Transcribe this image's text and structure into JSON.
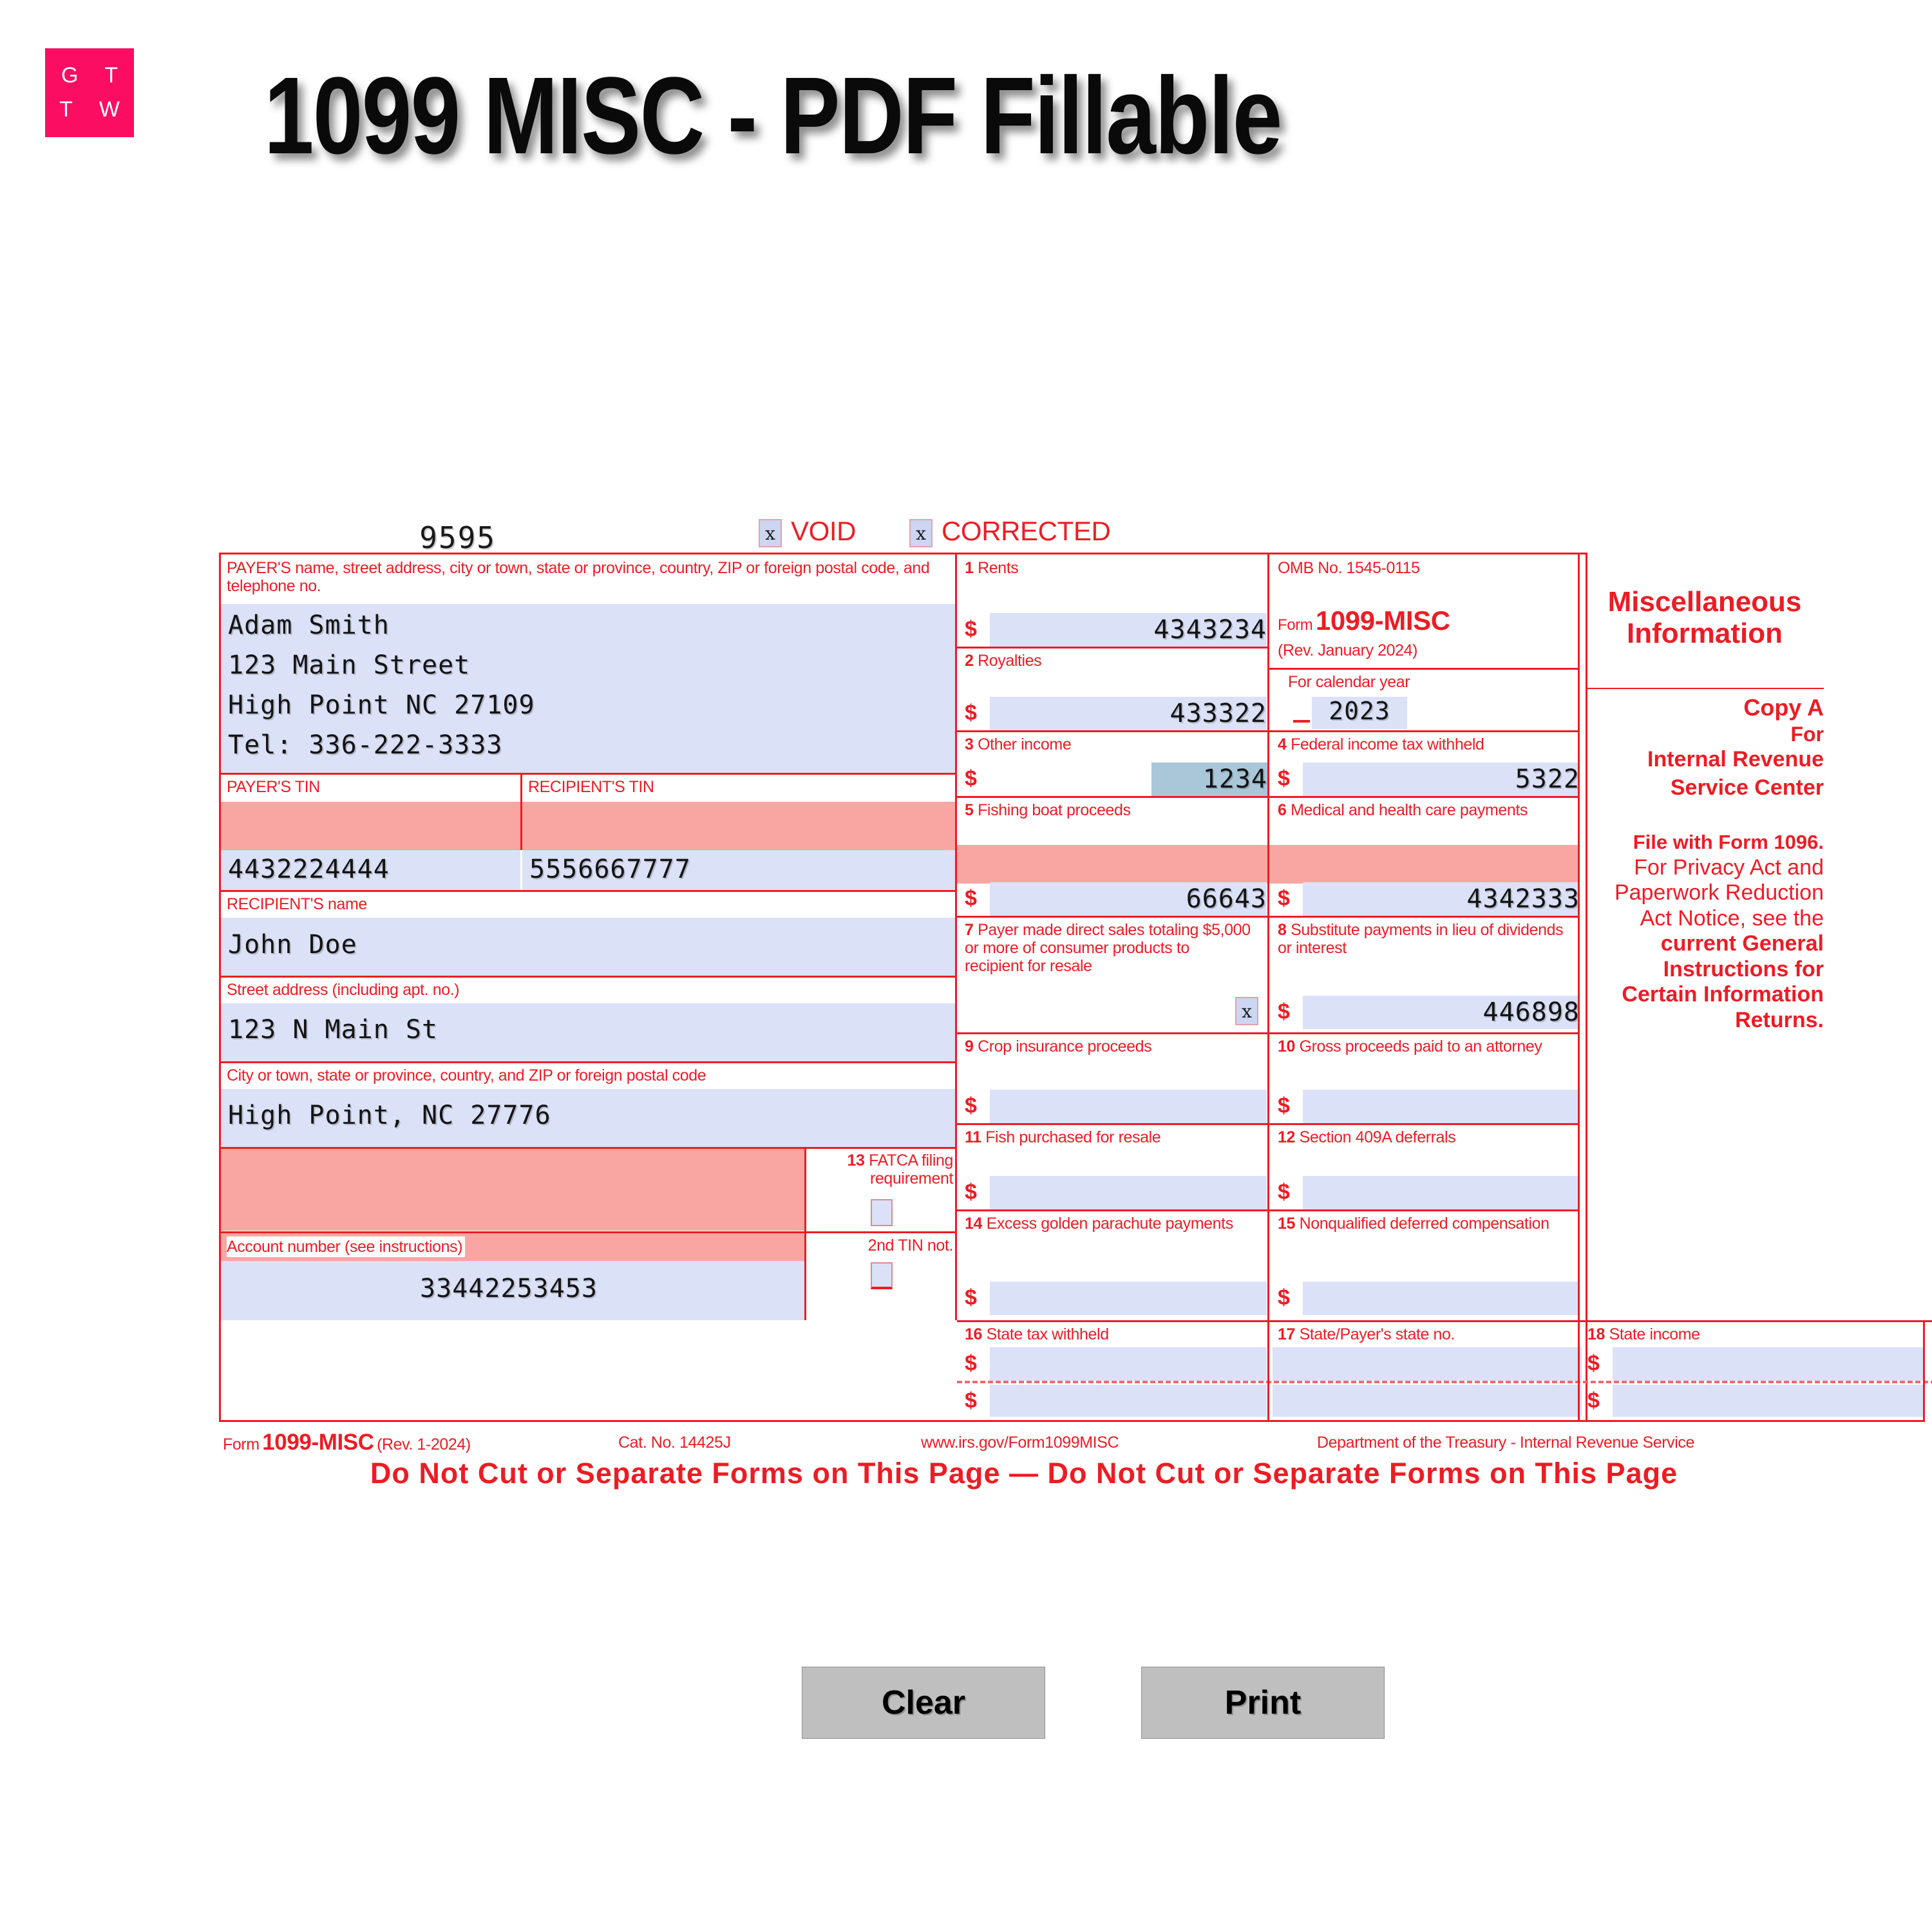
{
  "brand": {
    "line1": "G T",
    "line2": "T W",
    "color": "#fb0d61"
  },
  "page_title": "1099 MISC - PDF Fillable",
  "form": {
    "form_number_top": "9595",
    "void": {
      "label": "VOID",
      "checkbox_mark": "x",
      "checked": true
    },
    "corrected": {
      "label": "CORRECTED",
      "checkbox_mark": "x",
      "checked": true
    },
    "payer_block_label": "PAYER'S name, street address, city or town, state or province, country, ZIP or foreign postal code, and telephone no.",
    "payer_lines": [
      "Adam Smith",
      "123 Main Street",
      "High Point NC 27109",
      "Tel: 336-222-3333"
    ],
    "payer_tin_label": "PAYER'S TIN",
    "payer_tin_value": "4432224444",
    "recipient_tin_label": "RECIPIENT'S TIN",
    "recipient_tin_value": "5556667777",
    "recipient_name_label": "RECIPIENT'S name",
    "recipient_name_value": "John Doe",
    "street_label": "Street address (including apt. no.)",
    "street_value": "123 N Main St",
    "city_label": "City or town, state or province, country, and ZIP or foreign postal code",
    "city_value": "High Point, NC 27776",
    "fatca_label_num": "13",
    "fatca_label": "FATCA filing requirement",
    "account_label": "Account number (see instructions)",
    "account_value": "33442253453",
    "second_tin_label": "2nd TIN not.",
    "omb": "OMB No. 1545-0115",
    "form_word": "Form",
    "form_name": "1099-MISC",
    "revision": "(Rev. January 2024)",
    "calendar_year_label": "For calendar year",
    "calendar_year_value": "2023",
    "title_right_1": "Miscellaneous",
    "title_right_2": "Information",
    "copy_a": "Copy A",
    "copy_for": "For",
    "copy_irs_1": "Internal Revenue",
    "copy_irs_2": "Service Center",
    "file_with": "File with Form 1096.",
    "privacy_notice": "For Privacy Act and Paperwork Reduction Act Notice, see the",
    "privacy_notice_bold": "current General Instructions for Certain Information Returns.",
    "dollar_sign": "$",
    "boxes": [
      {
        "num": "1",
        "label": "Rents",
        "value": "4343234",
        "focused": false
      },
      {
        "num": "2",
        "label": "Royalties",
        "value": "433322",
        "focused": false
      },
      {
        "num": "3",
        "label": "Other income",
        "value": "1234",
        "focused": true
      },
      {
        "num": "4",
        "label": "Federal income tax withheld",
        "value": "5322",
        "focused": false
      },
      {
        "num": "5",
        "label": "Fishing boat proceeds",
        "value": "66643",
        "focused": false
      },
      {
        "num": "6",
        "label": "Medical and health care payments",
        "value": "4342333",
        "focused": false
      },
      {
        "num": "7",
        "label": "Payer made direct sales totaling $5,000 or more of consumer products to recipient for resale",
        "value": "x",
        "focused": false
      },
      {
        "num": "8",
        "label": "Substitute payments in lieu of dividends or interest",
        "value": "446898",
        "focused": false
      },
      {
        "num": "9",
        "label": "Crop insurance proceeds",
        "value": "",
        "focused": false
      },
      {
        "num": "10",
        "label": "Gross proceeds paid to an attorney",
        "value": "",
        "focused": false
      },
      {
        "num": "11",
        "label": "Fish purchased for resale",
        "value": "",
        "focused": false
      },
      {
        "num": "12",
        "label": "Section 409A deferrals",
        "value": "",
        "focused": false
      },
      {
        "num": "14",
        "label": "Excess golden parachute payments",
        "value": "",
        "focused": false
      },
      {
        "num": "15",
        "label": "Nonqualified deferred compensation",
        "value": "",
        "focused": false
      },
      {
        "num": "16",
        "label": "State tax withheld",
        "value": "",
        "focused": false
      },
      {
        "num": "17",
        "label": "State/Payer's state no.",
        "value": "",
        "focused": false
      },
      {
        "num": "18",
        "label": "State income",
        "value": "",
        "focused": false
      }
    ],
    "footer": {
      "form_word": "Form",
      "form_name": "1099-MISC",
      "revision": "(Rev. 1-2024)",
      "cat_no": "Cat. No. 14425J",
      "url": "www.irs.gov/Form1099MISC",
      "dept": "Department of the Treasury - Internal Revenue Service",
      "do_not_cut": "Do Not Cut or Separate Forms on This Page — Do Not Cut or Separate Forms on This Page"
    }
  },
  "buttons": {
    "clear": "Clear",
    "print": "Print"
  }
}
